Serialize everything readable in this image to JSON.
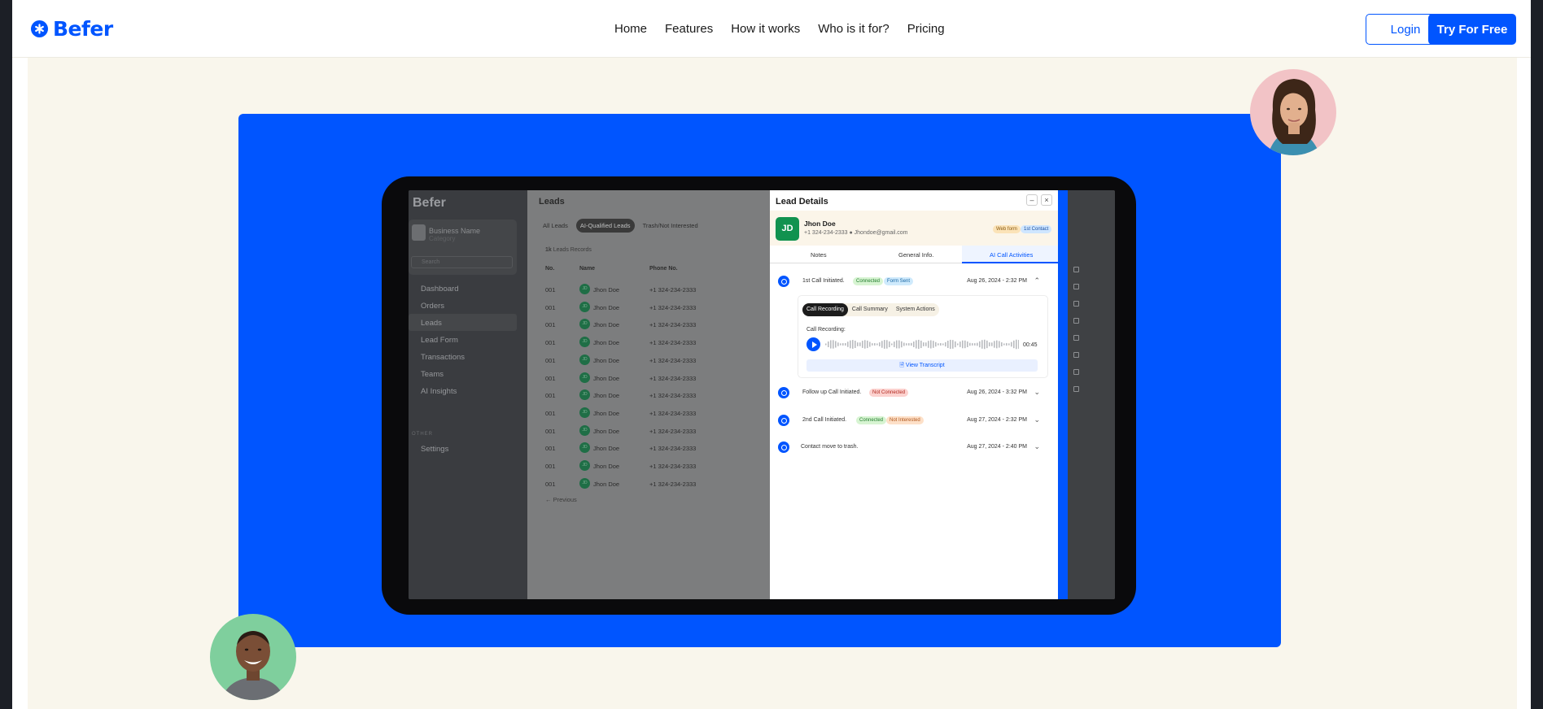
{
  "brand": {
    "name": "Befer"
  },
  "nav": {
    "items": [
      "Home",
      "Features",
      "How it works",
      "Who is it for?",
      "Pricing"
    ]
  },
  "auth": {
    "login": "Login",
    "try_free": "Try For Free"
  },
  "colors": {
    "accent": "#0055ff",
    "cream": "#f9f6ec"
  },
  "app": {
    "sidebar": {
      "title": "Befer",
      "business_name": "Business Name",
      "business_category": "Category",
      "search_placeholder": "Search",
      "items": [
        "Dashboard",
        "Orders",
        "Leads",
        "Lead Form",
        "Transactions",
        "Teams",
        "AI Insights"
      ],
      "active_item": "Leads",
      "other_label": "OTHER",
      "settings": "Settings"
    },
    "leads": {
      "title": "Leads",
      "tabs": [
        "All Leads",
        "AI-Qualified Leads",
        "Trash/Not Interested"
      ],
      "active_tab": "AI-Qualified Leads",
      "count": "1k",
      "count_label": "Leads Records",
      "columns": [
        "No.",
        "Name",
        "Phone No."
      ],
      "rows": [
        {
          "no": "001",
          "initials": "JD",
          "name": "Jhon Doe",
          "phone": "+1 324-234-2333"
        },
        {
          "no": "001",
          "initials": "JD",
          "name": "Jhon Doe",
          "phone": "+1 324-234-2333"
        },
        {
          "no": "001",
          "initials": "JD",
          "name": "Jhon Doe",
          "phone": "+1 324-234-2333"
        },
        {
          "no": "001",
          "initials": "JD",
          "name": "Jhon Doe",
          "phone": "+1 324-234-2333"
        },
        {
          "no": "001",
          "initials": "JD",
          "name": "Jhon Doe",
          "phone": "+1 324-234-2333"
        },
        {
          "no": "001",
          "initials": "JD",
          "name": "Jhon Doe",
          "phone": "+1 324-234-2333"
        },
        {
          "no": "001",
          "initials": "JD",
          "name": "Jhon Doe",
          "phone": "+1 324-234-2333"
        },
        {
          "no": "001",
          "initials": "JD",
          "name": "Jhon Doe",
          "phone": "+1 324-234-2333"
        },
        {
          "no": "001",
          "initials": "JD",
          "name": "Jhon Doe",
          "phone": "+1 324-234-2333"
        },
        {
          "no": "001",
          "initials": "JD",
          "name": "Jhon Doe",
          "phone": "+1 324-234-2333"
        },
        {
          "no": "001",
          "initials": "JD",
          "name": "Jhon Doe",
          "phone": "+1 324-234-2333"
        },
        {
          "no": "001",
          "initials": "JD",
          "name": "Jhon Doe",
          "phone": "+1 324-234-2333"
        }
      ],
      "previous": "Previous"
    },
    "details": {
      "title": "Lead Details",
      "initials": "JD",
      "name": "Jhon Doe",
      "phone": "+1 324-234-2333",
      "email": "Jhondoe@gmail.com",
      "tags": [
        "Web form",
        "1st Contact"
      ],
      "tabs": [
        "Notes",
        "General Info.",
        "AI Call Activities"
      ],
      "active_tab": "AI Call Activities",
      "activities": [
        {
          "title": "1st Call Initiated.",
          "badges": [
            "Connected",
            "Form Sent"
          ],
          "date": "Aug 26, 2024 - 2:32 PM",
          "expanded": true
        },
        {
          "title": "Follow up Call Initiated.",
          "badges": [
            "Not Connected"
          ],
          "date": "Aug 26, 2024 - 3:32 PM",
          "expanded": false
        },
        {
          "title": "2nd Call Initiated.",
          "badges": [
            "Connected",
            "Not Interested"
          ],
          "date": "Aug 27, 2024 - 2:32 PM",
          "expanded": false
        },
        {
          "title": "Contact move to trash.",
          "badges": [],
          "date": "Aug 27, 2024 - 2:40 PM",
          "expanded": false
        }
      ],
      "call_tabs": [
        "Call Recording",
        "Call Summary",
        "System Actions"
      ],
      "recording_label": "Call Recording:",
      "duration": "00:45",
      "view_transcript": "View Transcript"
    }
  }
}
